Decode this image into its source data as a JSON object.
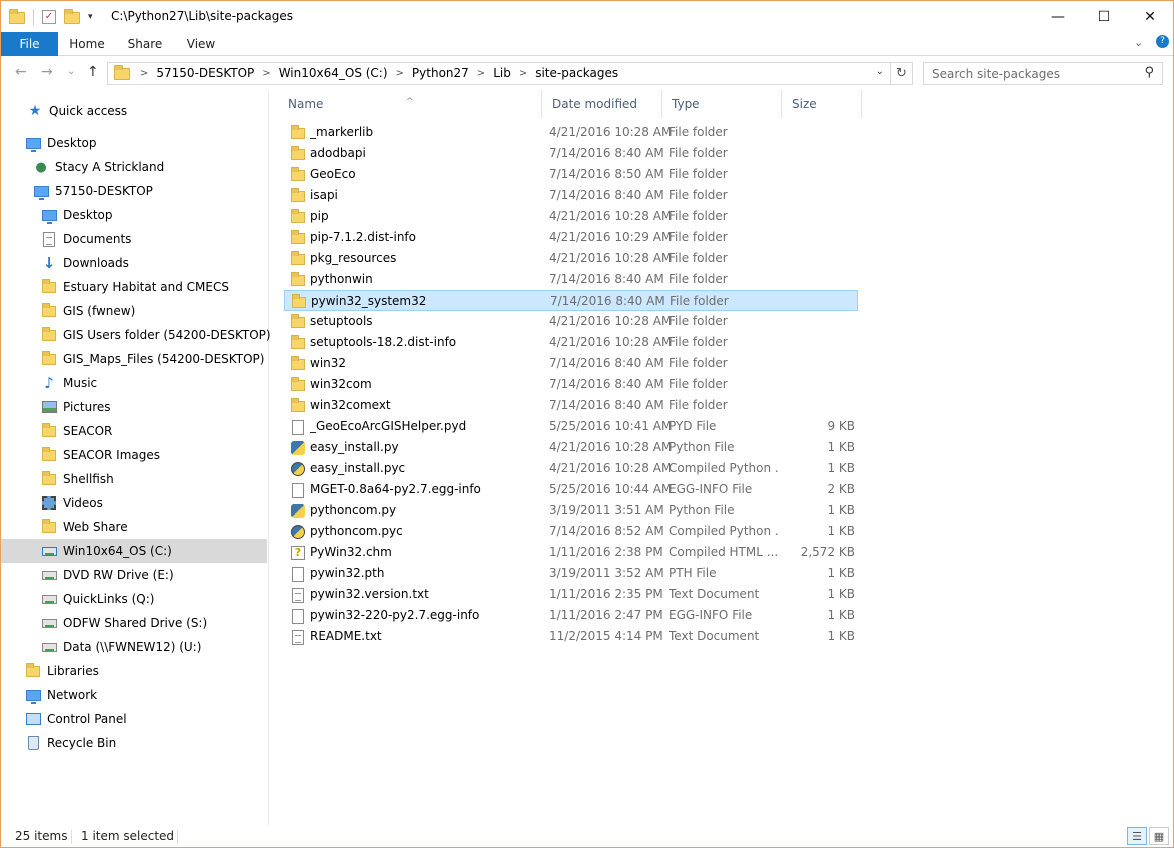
{
  "window": {
    "title": "C:\\Python27\\Lib\\site-packages",
    "minimize_glyph": "—",
    "maximize_glyph": "☐",
    "close_glyph": "✕"
  },
  "ribbon": {
    "tabs": [
      "File",
      "Home",
      "Share",
      "View"
    ],
    "expand_glyph": "⌄",
    "help_glyph": "?"
  },
  "nav_buttons": {
    "back": "←",
    "forward": "→",
    "recent": "⌄",
    "up": "↑"
  },
  "address": {
    "crumbs": [
      "57150-DESKTOP",
      "Win10x64_OS (C:)",
      "Python27",
      "Lib",
      "site-packages"
    ],
    "separator": ">",
    "dropdown_glyph": "⌄",
    "refresh_glyph": "↻"
  },
  "search": {
    "placeholder": "Search site-packages",
    "icon": "search-icon"
  },
  "sidebar": {
    "items": [
      {
        "label": "Quick access",
        "icon": "star-icon"
      },
      {
        "label": "Desktop",
        "icon": "desktop-icon"
      },
      {
        "label": "Stacy A Strickland",
        "icon": "user-icon"
      },
      {
        "label": "57150-DESKTOP",
        "icon": "computer-icon"
      },
      {
        "label": "Desktop",
        "icon": "desktop-icon"
      },
      {
        "label": "Documents",
        "icon": "documents-icon"
      },
      {
        "label": "Downloads",
        "icon": "download-icon"
      },
      {
        "label": "Estuary Habitat and CMECS",
        "icon": "folder-icon"
      },
      {
        "label": "GIS (fwnew)",
        "icon": "network-folder-icon"
      },
      {
        "label": "GIS Users folder (54200-DESKTOP)",
        "icon": "network-folder-icon"
      },
      {
        "label": "GIS_Maps_Files (54200-DESKTOP)",
        "icon": "network-folder-icon"
      },
      {
        "label": "Music",
        "icon": "music-icon"
      },
      {
        "label": "Pictures",
        "icon": "pictures-icon"
      },
      {
        "label": "SEACOR",
        "icon": "folder-icon"
      },
      {
        "label": "SEACOR Images",
        "icon": "folder-icon"
      },
      {
        "label": "Shellfish",
        "icon": "folder-icon"
      },
      {
        "label": "Videos",
        "icon": "videos-icon"
      },
      {
        "label": "Web Share",
        "icon": "folder-icon"
      },
      {
        "label": "Win10x64_OS (C:)",
        "icon": "windows-drive-icon"
      },
      {
        "label": "DVD RW Drive (E:)",
        "icon": "dvd-drive-icon"
      },
      {
        "label": "QuickLinks (Q:)",
        "icon": "network-drive-icon"
      },
      {
        "label": "ODFW Shared Drive (S:)",
        "icon": "network-drive-icon"
      },
      {
        "label": "Data (\\\\FWNEW12) (U:)",
        "icon": "network-drive-icon"
      },
      {
        "label": "Libraries",
        "icon": "libraries-icon"
      },
      {
        "label": "Network",
        "icon": "network-icon"
      },
      {
        "label": "Control Panel",
        "icon": "control-panel-icon"
      },
      {
        "label": "Recycle Bin",
        "icon": "recycle-bin-icon"
      }
    ]
  },
  "columns": {
    "name": "Name",
    "date": "Date modified",
    "type": "Type",
    "size": "Size",
    "sort_glyph": "^"
  },
  "files": [
    {
      "name": "_markerlib",
      "date": "4/21/2016 10:28 AM",
      "type": "File folder",
      "size": "",
      "icon": "folder-icon"
    },
    {
      "name": "adodbapi",
      "date": "7/14/2016 8:40 AM",
      "type": "File folder",
      "size": "",
      "icon": "folder-icon"
    },
    {
      "name": "GeoEco",
      "date": "7/14/2016 8:50 AM",
      "type": "File folder",
      "size": "",
      "icon": "folder-icon"
    },
    {
      "name": "isapi",
      "date": "7/14/2016 8:40 AM",
      "type": "File folder",
      "size": "",
      "icon": "folder-icon"
    },
    {
      "name": "pip",
      "date": "4/21/2016 10:28 AM",
      "type": "File folder",
      "size": "",
      "icon": "folder-icon"
    },
    {
      "name": "pip-7.1.2.dist-info",
      "date": "4/21/2016 10:29 AM",
      "type": "File folder",
      "size": "",
      "icon": "folder-icon"
    },
    {
      "name": "pkg_resources",
      "date": "4/21/2016 10:28 AM",
      "type": "File folder",
      "size": "",
      "icon": "folder-icon"
    },
    {
      "name": "pythonwin",
      "date": "7/14/2016 8:40 AM",
      "type": "File folder",
      "size": "",
      "icon": "folder-icon"
    },
    {
      "name": "pywin32_system32",
      "date": "7/14/2016 8:40 AM",
      "type": "File folder",
      "size": "",
      "icon": "folder-icon",
      "selected": true
    },
    {
      "name": "setuptools",
      "date": "4/21/2016 10:28 AM",
      "type": "File folder",
      "size": "",
      "icon": "folder-icon"
    },
    {
      "name": "setuptools-18.2.dist-info",
      "date": "4/21/2016 10:28 AM",
      "type": "File folder",
      "size": "",
      "icon": "folder-icon"
    },
    {
      "name": "win32",
      "date": "7/14/2016 8:40 AM",
      "type": "File folder",
      "size": "",
      "icon": "folder-icon"
    },
    {
      "name": "win32com",
      "date": "7/14/2016 8:40 AM",
      "type": "File folder",
      "size": "",
      "icon": "folder-icon"
    },
    {
      "name": "win32comext",
      "date": "7/14/2016 8:40 AM",
      "type": "File folder",
      "size": "",
      "icon": "folder-icon"
    },
    {
      "name": "_GeoEcoArcGISHelper.pyd",
      "date": "5/25/2016 10:41 AM",
      "type": "PYD File",
      "size": "9 KB",
      "icon": "file-icon"
    },
    {
      "name": "easy_install.py",
      "date": "4/21/2016 10:28 AM",
      "type": "Python File",
      "size": "1 KB",
      "icon": "python-file-icon"
    },
    {
      "name": "easy_install.pyc",
      "date": "4/21/2016 10:28 AM",
      "type": "Compiled Python ...",
      "size": "1 KB",
      "icon": "compiled-python-icon"
    },
    {
      "name": "MGET-0.8a64-py2.7.egg-info",
      "date": "5/25/2016 10:44 AM",
      "type": "EGG-INFO File",
      "size": "2 KB",
      "icon": "file-icon"
    },
    {
      "name": "pythoncom.py",
      "date": "3/19/2011 3:51 AM",
      "type": "Python File",
      "size": "1 KB",
      "icon": "python-file-icon"
    },
    {
      "name": "pythoncom.pyc",
      "date": "7/14/2016 8:52 AM",
      "type": "Compiled Python ...",
      "size": "1 KB",
      "icon": "compiled-python-icon"
    },
    {
      "name": "PyWin32.chm",
      "date": "1/11/2016 2:38 PM",
      "type": "Compiled HTML ...",
      "size": "2,572 KB",
      "icon": "help-file-icon"
    },
    {
      "name": "pywin32.pth",
      "date": "3/19/2011 3:52 AM",
      "type": "PTH File",
      "size": "1 KB",
      "icon": "file-icon"
    },
    {
      "name": "pywin32.version.txt",
      "date": "1/11/2016 2:35 PM",
      "type": "Text Document",
      "size": "1 KB",
      "icon": "text-file-icon"
    },
    {
      "name": "pywin32-220-py2.7.egg-info",
      "date": "1/11/2016 2:47 PM",
      "type": "EGG-INFO File",
      "size": "1 KB",
      "icon": "file-icon"
    },
    {
      "name": "README.txt",
      "date": "11/2/2015 4:14 PM",
      "type": "Text Document",
      "size": "1 KB",
      "icon": "text-file-icon"
    }
  ],
  "status": {
    "count": "25 items",
    "selection": "1 item selected"
  },
  "colors": {
    "accent": "#1979ca",
    "selection_bg": "#cce8ff",
    "selection_border": "#99d1ff",
    "window_border": "#e8a05a"
  }
}
